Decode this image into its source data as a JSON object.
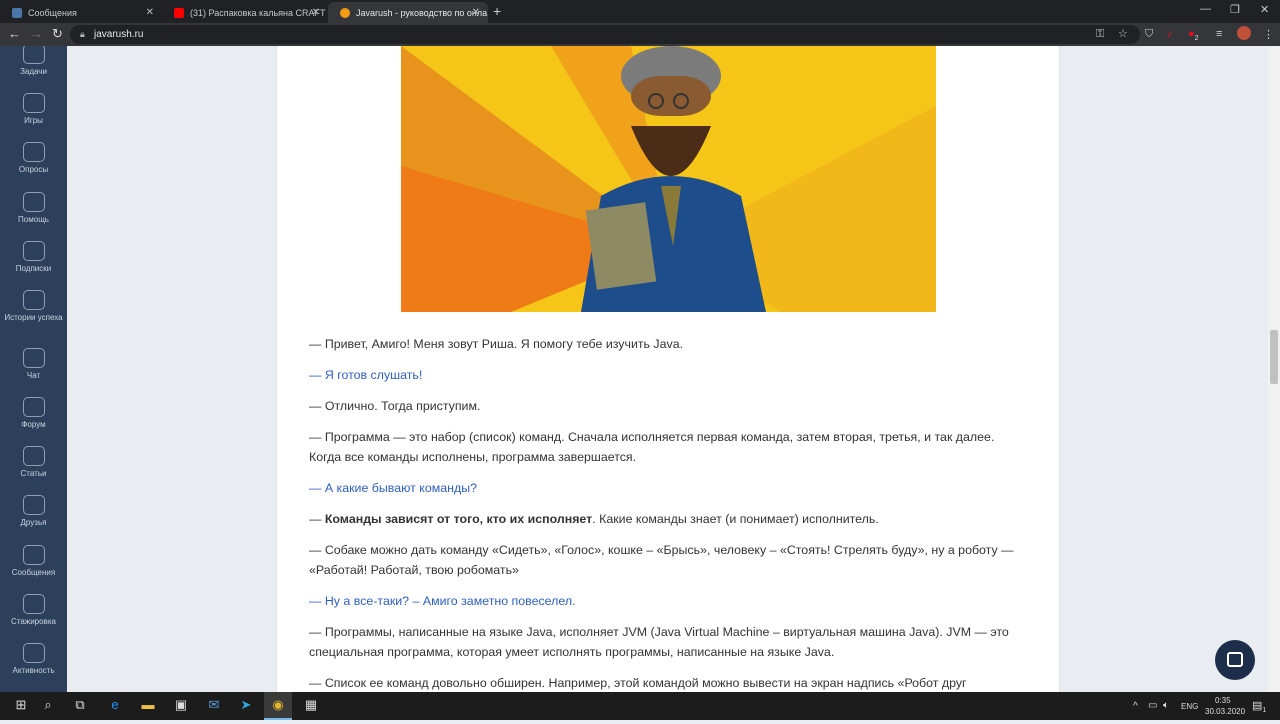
{
  "browser": {
    "tabs": [
      {
        "title": "Сообщения",
        "favicon": "vk-messages-icon",
        "color": "#4a76a8"
      },
      {
        "title": "(31) Распаковка кальяна CRAFT",
        "favicon": "youtube-icon",
        "color": "#ff0000"
      },
      {
        "title": "Javarush - руководство по онла",
        "favicon": "javarush-icon",
        "color": "#f39c12",
        "active": true
      }
    ],
    "address": "javarush.ru"
  },
  "sidebar": {
    "items": [
      "Задачи",
      "Игры",
      "Опросы",
      "Помощь",
      "Подписки",
      "Истории успеха",
      "Чат",
      "Форум",
      "Статьи",
      "Друзья",
      "Сообщения",
      "Стажировка",
      "Активность"
    ]
  },
  "article": {
    "paragraphs": [
      {
        "text": "— Привет, Амиго! Меня зовут Риша. Я помогу тебе изучить Java.",
        "link": false
      },
      {
        "text": "— Я готов слушать!",
        "link": true
      },
      {
        "text": "— Отлично. Тогда приступим.",
        "link": false
      },
      {
        "text": "— Программа — это набор (список) команд. Сначала исполняется первая команда, затем вторая, третья, и так далее. Когда все команды исполнены, программа завершается.",
        "link": false
      },
      {
        "text": "— А какие бывают команды?",
        "link": true
      },
      {
        "bold": "Команды зависят от того, кто их исполняет",
        "prefix": "— ",
        "text": ". Какие команды знает (и понимает) исполнитель.",
        "link": false
      },
      {
        "text": "— Собаке можно дать команду «Сидеть», «Голос», кошке – «Брысь», человеку – «Стоять! Стрелять буду», ну а роботу — «Работай! Работай, твою робомать»",
        "link": false
      },
      {
        "text": "— Ну а все-таки? – Амиго заметно повеселел.",
        "link": true
      },
      {
        "text": "— Программы, написанные на языке Java, исполняет JVM (Java Virtual Machine – виртуальная машина Java). JVM — это специальная программа, которая умеет исполнять программы, написанные на языке Java.",
        "link": false
      },
      {
        "text": "— Список ее команд довольно обширен. Например, этой командой можно вывести на экран надпись «Робот друг человека».",
        "link": false
      }
    ]
  },
  "taskbar": {
    "lang": "ENG",
    "time": "0:35",
    "date": "30.03.2020",
    "notifications": "1",
    "ext_badge": "2"
  },
  "colors": {
    "sidebar": "#2c3f5b",
    "link": "#2f5fbf"
  }
}
